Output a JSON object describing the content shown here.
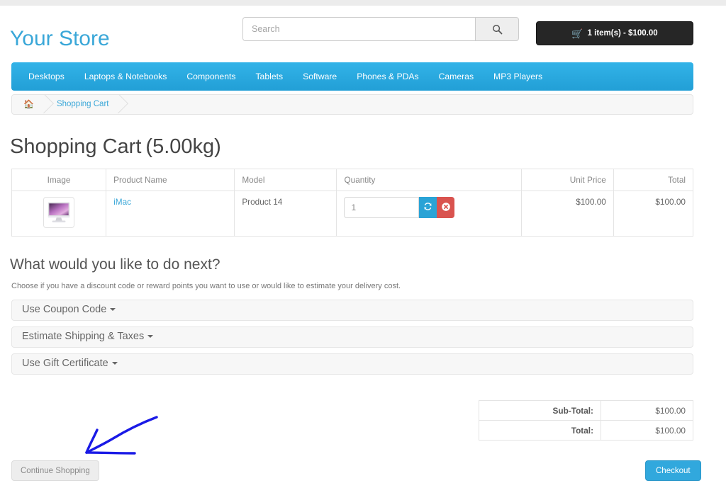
{
  "header": {
    "logo": "Your Store",
    "search": {
      "placeholder": "Search",
      "value": "",
      "button_icon": "search-icon"
    },
    "cart_button": {
      "icon": "cart-icon",
      "label": "1 item(s) - $100.00"
    }
  },
  "nav": {
    "items": [
      {
        "label": "Desktops"
      },
      {
        "label": "Laptops & Notebooks"
      },
      {
        "label": "Components"
      },
      {
        "label": "Tablets"
      },
      {
        "label": "Software"
      },
      {
        "label": "Phones & PDAs"
      },
      {
        "label": "Cameras"
      },
      {
        "label": "MP3 Players"
      }
    ]
  },
  "breadcrumb": {
    "home_icon": "home-icon",
    "items": [
      {
        "label": "Shopping Cart"
      }
    ]
  },
  "page": {
    "title": "Shopping Cart",
    "weight": "(5.00kg)"
  },
  "cart": {
    "headers": {
      "image": "Image",
      "product_name": "Product Name",
      "model": "Model",
      "quantity": "Quantity",
      "unit_price": "Unit Price",
      "total": "Total"
    },
    "rows": [
      {
        "image_icon": "imac-thumbnail",
        "product_name": "iMac",
        "model": "Product 14",
        "quantity": "1",
        "update_icon": "refresh-icon",
        "remove_icon": "remove-circle-icon",
        "unit_price": "$100.00",
        "total": "$100.00"
      }
    ]
  },
  "next_section": {
    "title": "What would you like to do next?",
    "subtitle": "Choose if you have a discount code or reward points you want to use or would like to estimate your delivery cost.",
    "panels": [
      {
        "label": "Use Coupon Code"
      },
      {
        "label": "Estimate Shipping & Taxes"
      },
      {
        "label": "Use Gift Certificate"
      }
    ]
  },
  "totals": {
    "rows": [
      {
        "label": "Sub-Total:",
        "value": "$100.00"
      },
      {
        "label": "Total:",
        "value": "$100.00"
      }
    ]
  },
  "footer": {
    "continue_label": "Continue Shopping",
    "checkout_label": "Checkout"
  },
  "annotation": {
    "type": "hand-drawn-arrow",
    "color": "#1a1ae6",
    "points_to": "continue-shopping-button"
  },
  "colors": {
    "brand_blue": "#3aa7d8",
    "nav_blue": "#2aa8dd",
    "cart_black": "#262626",
    "danger_red": "#d9534f",
    "annotation_blue": "#1a1ae6"
  }
}
